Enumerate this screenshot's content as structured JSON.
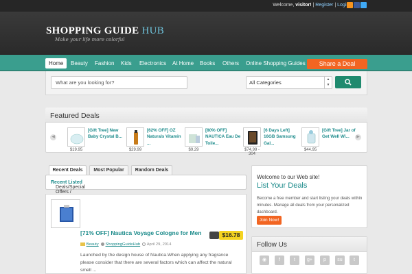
{
  "topbar": {
    "welcome": "Welcome,",
    "user": "visitor!",
    "register": "Register",
    "login": "Login",
    "social": [
      "rss-icon",
      "facebook-icon",
      "twitter-icon"
    ]
  },
  "header": {
    "logo_main": "SHOPPING GUIDE",
    "logo_accent": "HUB",
    "tagline": "Make your life more colorful"
  },
  "nav": {
    "items": [
      "Home",
      "Beauty",
      "Fashion",
      "Kids",
      "Electronics",
      "At Home",
      "Books",
      "Others",
      "Online Shopping Guides"
    ],
    "active": "Home",
    "share_label": "Share a Deal"
  },
  "search": {
    "placeholder": "What are you looking for?",
    "category": "All Categories"
  },
  "featured": {
    "title": "Featured Deals",
    "deals": [
      {
        "title": "[Gift Tree] New Baby Crystal B...",
        "price": "$19.95"
      },
      {
        "title": "[62% OFF] OZ Naturals Vitamin ...",
        "price": "$29.99"
      },
      {
        "title": "[80% OFF] NAUTICA Eau De Toile...",
        "price": "$9.29"
      },
      {
        "title": "[6 Days Left] 16GB Samsung Gal...",
        "price": "$74.99 - 304"
      },
      {
        "title": "[Gift Tree] Jar of Get Well Wi...",
        "price": "$44.95"
      }
    ]
  },
  "tabs": [
    "Recent Deals",
    "Most Popular",
    "Random Deals"
  ],
  "crumb": {
    "prefix": "Deals/Special Offers /",
    "current": "Recent Listed"
  },
  "post": {
    "title": "[71% OFF] Nautica Voyage Cologne for Men",
    "price": "$16.78",
    "category": "Beauty",
    "author": "ShoppingGuideHub",
    "date": "April 29, 2014",
    "desc": "Launched by the design house of Nautica.When applying any fragrance please consider that there are several factors which can affect the natural smell ..."
  },
  "welcome_box": {
    "line1": "Welcome to our Web site!",
    "line2": "List Your Deals",
    "text": "Become a free member and start listing your deals within minutes. Manage all deals from your personalized dashboard.",
    "button": "Join Now!"
  },
  "follow": {
    "title": "Follow Us",
    "icons": [
      "rss-icon",
      "facebook-icon",
      "twitter-icon",
      "google-plus-icon",
      "pinterest-icon",
      "stumbleupon-icon",
      "tumblr-icon"
    ]
  },
  "colors": {
    "accent": "#3a9e8e",
    "orange": "#f26522",
    "link": "#1a8a8a",
    "price": "#f4d321"
  }
}
